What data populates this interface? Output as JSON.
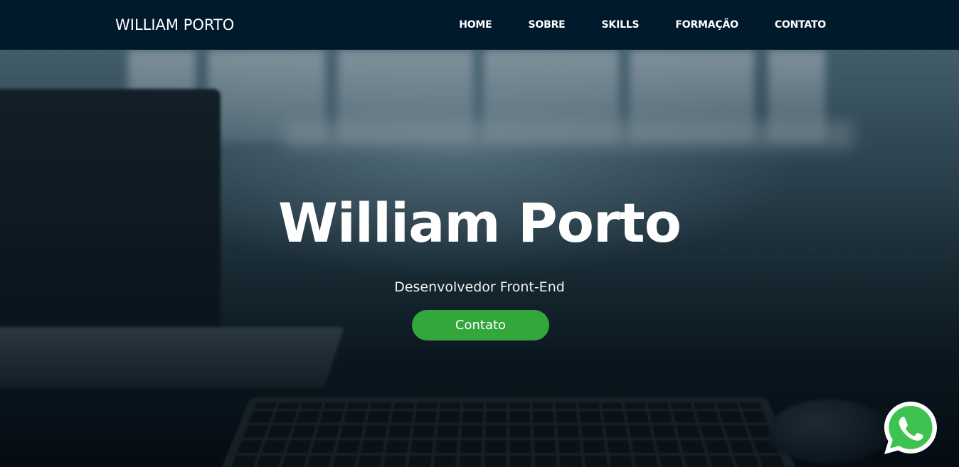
{
  "navbar": {
    "brand": "WILLIAM PORTO",
    "links": [
      {
        "label": "HOME"
      },
      {
        "label": "SOBRE"
      },
      {
        "label": "SKILLS"
      },
      {
        "label": "FORMAÇÃO"
      },
      {
        "label": "CONTATO"
      }
    ]
  },
  "hero": {
    "title": "William Porto",
    "subtitle": "Desenvolvedor Front-End",
    "button_label": "Contato"
  },
  "whatsapp": {
    "icon": "whatsapp-icon"
  },
  "colors": {
    "navbar_bg": "#001a2c",
    "button_bg": "#33a63c",
    "whatsapp_green": "#3fc350",
    "text": "#ffffff"
  }
}
